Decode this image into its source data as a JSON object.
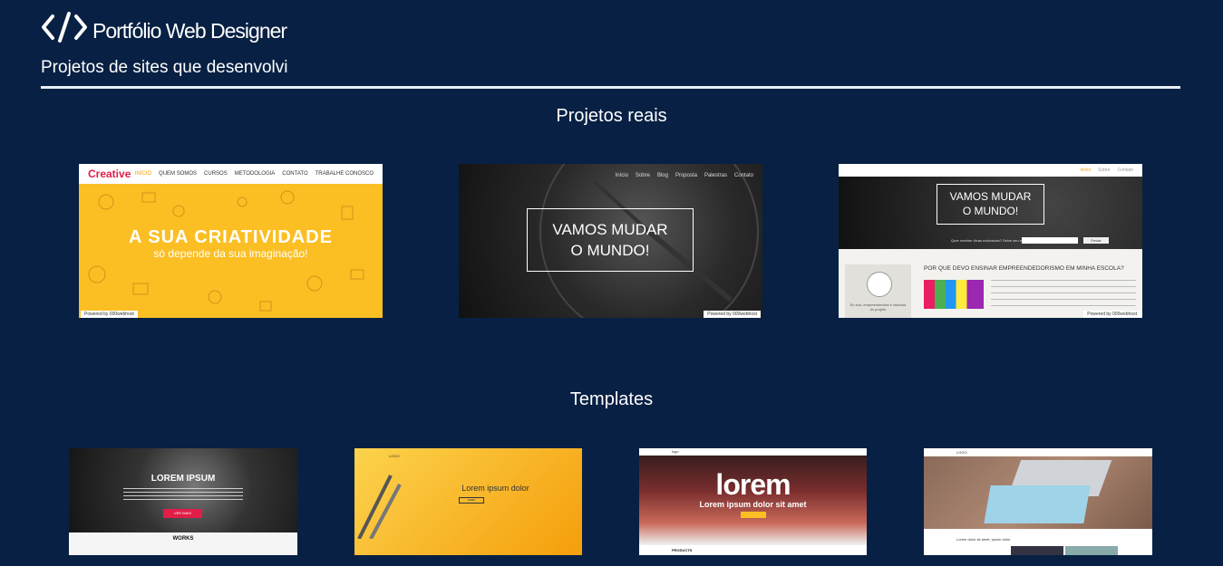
{
  "header": {
    "icon": "code-icon",
    "title": "Portfólio Web Designer",
    "subtitle": "Projetos de sites que desenvolvi"
  },
  "sections": {
    "real_projects": "Projetos reais",
    "templates": "Templates"
  },
  "projects": [
    {
      "name": "creative",
      "logo": "Creative",
      "nav": [
        "INÍCIO",
        "QUEM SOMOS",
        "CURSOS",
        "METODOLOGIA",
        "CONTATO",
        "TRABALHE CONOSCO"
      ],
      "headline": "A SUA CRIATIVIDADE",
      "tagline": "só depende da sua imaginação!",
      "powered": "Powered by 000webhost"
    },
    {
      "name": "vamos-mudar-dark",
      "nav": [
        "Início",
        "Sobre",
        "Blog",
        "Proposta",
        "Palestras",
        "Contato"
      ],
      "headline_1": "VAMOS MUDAR",
      "headline_2": "O MUNDO!",
      "powered": "Powered by 000webhost"
    },
    {
      "name": "vamos-mudar-blog",
      "nav": [
        "Início",
        "Sobre",
        "Contato"
      ],
      "headline_1": "VAMOS MUDAR",
      "headline_2": "O MUNDO!",
      "newsletter": "Quer receber dicas exclusivas? Deixe seu e-mail",
      "button": "Enviar",
      "post_title": "POR QUE DEVO ENSINAR EMPREENDEDORISMO EM MINHA ESCOLA?",
      "author": "Eu sou, empreendedora e criadora do projeto",
      "powered": "Powered by 000webhost"
    }
  ],
  "templates": [
    {
      "name": "lorem-ipsum-dark",
      "headline": "LOREM IPSUM",
      "button": "VER MAIS",
      "section": "WORKS"
    },
    {
      "name": "lorem-yellow",
      "logo": "LOGO",
      "headline": "Lorem ipsum dolor",
      "button": "SAIBA"
    },
    {
      "name": "lorem-red",
      "logo": "logo",
      "headline": "lorem",
      "sub": "Lorem ipsum dolor sit amet",
      "section": "PRODUCTS"
    },
    {
      "name": "laptop-desk",
      "logo": "LOGO",
      "caption": "Lorem dolor sit amet, ipsum dolor"
    }
  ],
  "colors": {
    "background": "#082043",
    "yellow": "#fbbf24",
    "orange": "#f59e0b",
    "pink": "#e11d48"
  }
}
